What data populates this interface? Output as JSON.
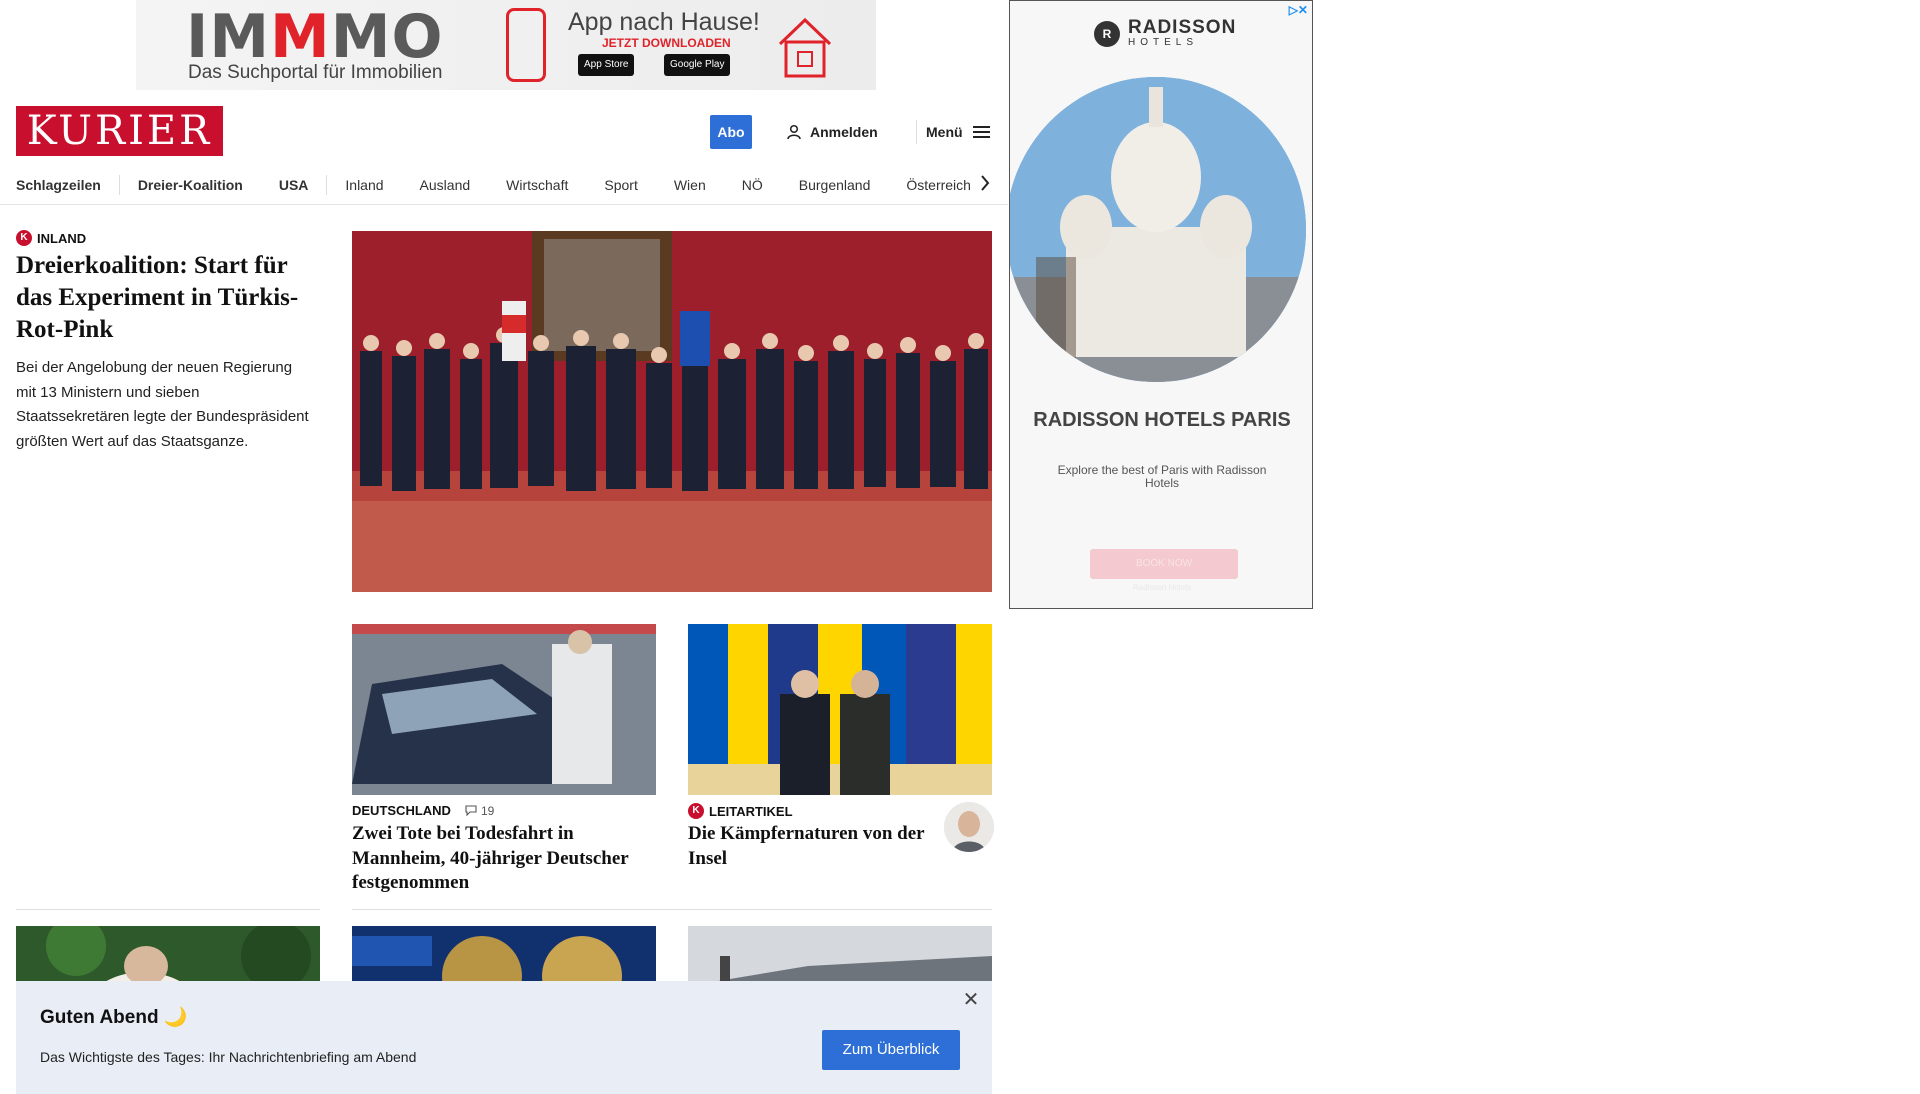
{
  "top_ad": {
    "brand": "IMMMO",
    "tagline": "Das Suchportal für Immobilien",
    "headline": "App nach Hause!",
    "cta": "JETZT DOWNLOADEN",
    "store_apple": "App Store",
    "store_google": "Google Play"
  },
  "header": {
    "logo": "KURIER",
    "abo_label": "Abo",
    "login_label": "Anmelden",
    "menu_label": "Menü"
  },
  "nav": {
    "items": [
      "Schlagzeilen",
      "Dreier-Koalition",
      "USA",
      "Inland",
      "Ausland",
      "Wirtschaft",
      "Sport",
      "Wien",
      "NÖ",
      "Burgenland",
      "Österreich"
    ]
  },
  "lead": {
    "kicker": "Inland",
    "title": "Dreierkoalition: Start für das Experiment in Türkis-Rot-Pink",
    "teaser": "Bei der Angelobung der neuen Regierung mit 13 Ministern und sieben Staatssekretären legte der Bundespräsident größten Wert auf das Staatsganze."
  },
  "article_a": {
    "kicker": "Deutschland",
    "comments": "19",
    "title": "Zwei Tote bei Todesfahrt in Mannheim, 40-jähriger Deutscher festgenommen"
  },
  "article_b": {
    "kicker": "Leitartikel",
    "title": "Die Kämpfernaturen von der Insel"
  },
  "briefing": {
    "title": "Guten Abend 🌙",
    "text": "Das Wichtigste des Tages: Ihr Nachrichtenbriefing am Abend",
    "button": "Zum Überblick"
  },
  "side_ad": {
    "brand": "RADISSON",
    "brand_sub": "HOTELS",
    "headline": "RADISSON HOTELS PARIS",
    "sub": "Explore the best of Paris with Radisson Hotels",
    "button": "BOOK NOW",
    "footer": "Radisson Hotels"
  },
  "colors": {
    "brand_red": "#c8102e",
    "accent_blue": "#2d6fd6",
    "briefing_bg": "#e9eef6"
  }
}
